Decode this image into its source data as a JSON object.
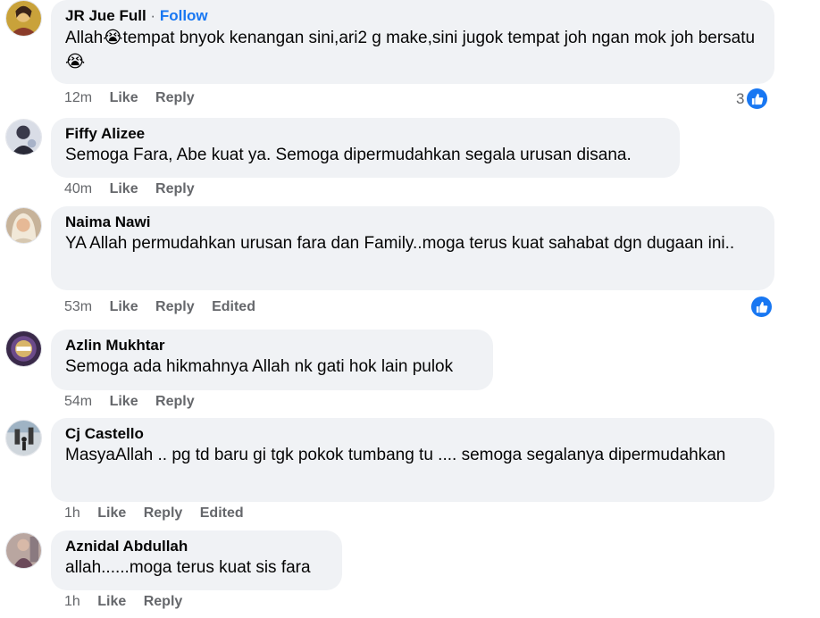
{
  "comments": [
    {
      "name": "JR Jue Full",
      "separator": "·",
      "follow": "Follow",
      "text_part1": "Allah",
      "emoji1": "😭",
      "text_part2": "tempat bnyok kenangan sini,ari2 g make,sini jugok tempat joh ngan mok joh bersatu ",
      "emoji2": "😭",
      "time": "12m",
      "like": "Like",
      "reply": "Reply",
      "reactions": "3",
      "avatar_icon": "profile-photo"
    },
    {
      "name": "Fiffy Alizee",
      "text": "Semoga Fara, Abe kuat ya. Semoga dipermudahkan segala urusan disana.",
      "time": "40m",
      "like": "Like",
      "reply": "Reply",
      "avatar_icon": "profile-photo"
    },
    {
      "name": "Naima Nawi",
      "text": "YA Allah permudahkan urusan fara dan Family..moga terus kuat sahabat dgn dugaan ini..",
      "time": "53m",
      "like": "Like",
      "reply": "Reply",
      "edited": "Edited",
      "avatar_icon": "profile-photo"
    },
    {
      "name": "Azlin Mukhtar",
      "text": "Semoga ada hikmahnya Allah nk gati hok lain pulok",
      "time": "54m",
      "like": "Like",
      "reply": "Reply",
      "avatar_icon": "profile-photo"
    },
    {
      "name": "Cj Castello",
      "text": "MasyaAllah .. pg td baru gi tgk pokok tumbang tu .... semoga segalanya dipermudahkan",
      "time": "1h",
      "like": "Like",
      "reply": "Reply",
      "edited": "Edited",
      "avatar_icon": "profile-photo"
    },
    {
      "name": "Aznidal Abdullah",
      "text": "allah......moga terus kuat sis fara",
      "time": "1h",
      "like": "Like",
      "reply": "Reply",
      "avatar_icon": "profile-photo"
    }
  ],
  "colors": {
    "bubble": "#f0f2f5",
    "meta": "#65676b",
    "link": "#1877f2"
  }
}
